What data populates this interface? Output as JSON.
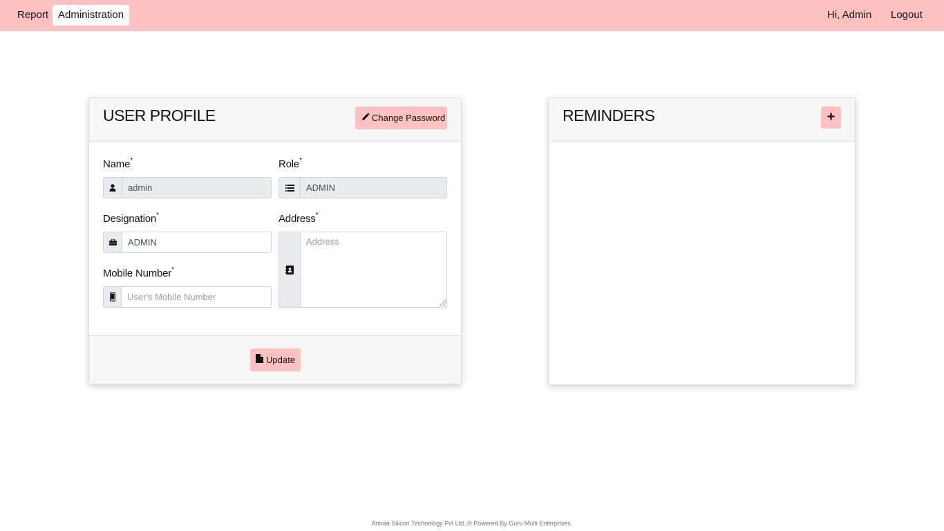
{
  "navbar": {
    "left_items": [
      {
        "label": "Report"
      },
      {
        "label": "Administration",
        "active": true
      }
    ],
    "greeting": "Hi, Admin",
    "logout_label": "Logout"
  },
  "profile_card": {
    "title": "USER PROFILE",
    "change_password_label": "Change Password",
    "change_password_icon": "pencil-icon",
    "fields": {
      "name": {
        "label": "Name",
        "required_mark": "*",
        "value": "admin",
        "icon": "user-icon",
        "disabled": true
      },
      "role": {
        "label": "Role",
        "required_mark": "*",
        "value": "ADMIN",
        "icon": "list-icon",
        "disabled": true
      },
      "designation": {
        "label": "Designation",
        "required_mark": "*",
        "value": "ADMIN",
        "icon": "briefcase-icon"
      },
      "address": {
        "label": "Address",
        "required_mark": "*",
        "value": "",
        "placeholder": "Address",
        "icon": "address-book-icon"
      },
      "mobile": {
        "label": "Mobile Number",
        "required_mark": "*",
        "value": "",
        "placeholder": "User's Mobile Number",
        "icon": "mobile-phone-icon"
      }
    },
    "update_label": "Update",
    "update_icon": "file-icon"
  },
  "reminders_card": {
    "title": "REMINDERS",
    "add_label": "+"
  },
  "footer": {
    "text": "Annaa Silicon Technology Pvt Ltd.,® Powered By  Guru Multi Enterprises."
  },
  "colors": {
    "accent_pink": "#fdc1c1",
    "card_header_bg": "#f7f7f7",
    "disabled_input_bg": "#e9ecef"
  }
}
